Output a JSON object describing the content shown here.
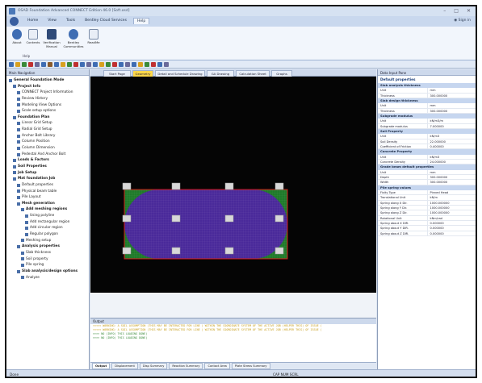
{
  "window": {
    "title": "OSAD Foundation Advanced CONNECT Edition 46.0 [Soft.osd]",
    "controls": [
      "–",
      "□",
      "✕"
    ]
  },
  "menubar": {
    "tabs": [
      {
        "label": "Home",
        "active": false
      },
      {
        "label": "View",
        "active": false
      },
      {
        "label": "Tools",
        "active": false
      },
      {
        "label": "Bentley Cloud Services",
        "active": false
      },
      {
        "label": "Help",
        "active": true
      }
    ],
    "signin": "Sign in"
  },
  "ribbon": {
    "buttons": [
      {
        "label": "About",
        "icon": "info-icon"
      },
      {
        "label": "Contents",
        "icon": "help-icon"
      },
      {
        "label": "Verification Manual",
        "icon": "book-icon"
      },
      {
        "label": "Bentley Communities",
        "icon": "community-icon"
      },
      {
        "label": "ReadMe",
        "icon": "document-icon"
      }
    ],
    "group_label": "Help"
  },
  "left_panel": {
    "title": "Main Navigation",
    "items": [
      {
        "label": "General Foundation Mode",
        "level": 0,
        "bold": true
      },
      {
        "label": "Project Info",
        "level": 1,
        "bold": true
      },
      {
        "label": "CONNECT Project Information",
        "level": 2,
        "bold": false
      },
      {
        "label": "Review History",
        "level": 2,
        "bold": false
      },
      {
        "label": "Modeling View Options",
        "level": 2,
        "bold": false
      },
      {
        "label": "Scale setup options",
        "level": 2,
        "bold": false
      },
      {
        "label": "Foundation Plan",
        "level": 1,
        "bold": true
      },
      {
        "label": "Linear Grid Setup",
        "level": 2,
        "bold": false
      },
      {
        "label": "Radial Grid Setup",
        "level": 2,
        "bold": false
      },
      {
        "label": "Anchor Bolt Library",
        "level": 2,
        "bold": false
      },
      {
        "label": "Column Position",
        "level": 2,
        "bold": false
      },
      {
        "label": "Column Dimension",
        "level": 2,
        "bold": false
      },
      {
        "label": "Pedestal And Anchor Bolt",
        "level": 2,
        "bold": false
      },
      {
        "label": "Loads & Factors",
        "level": 1,
        "bold": true
      },
      {
        "label": "Soil Properties",
        "level": 1,
        "bold": true
      },
      {
        "label": "Job Setup",
        "level": 1,
        "bold": true
      },
      {
        "label": "Mat foundation Job",
        "level": 1,
        "bold": true
      },
      {
        "label": "Default properties",
        "level": 2,
        "bold": false
      },
      {
        "label": "Physical beam table",
        "level": 2,
        "bold": false
      },
      {
        "label": "Pile Layout",
        "level": 2,
        "bold": false
      },
      {
        "label": "Mesh generation",
        "level": 2,
        "bold": true
      },
      {
        "label": "Add meshing regions",
        "level": 3,
        "bold": true
      },
      {
        "label": "Using polyline",
        "level": 4,
        "bold": false
      },
      {
        "label": "Add rectangular region",
        "level": 4,
        "bold": false
      },
      {
        "label": "Add circular region",
        "level": 4,
        "bold": false
      },
      {
        "label": "Regular polygon",
        "level": 4,
        "bold": false
      },
      {
        "label": "Meshing setup",
        "level": 3,
        "bold": false
      },
      {
        "label": "Analysis properties",
        "level": 2,
        "bold": true
      },
      {
        "label": "Slab thickness",
        "level": 3,
        "bold": false
      },
      {
        "label": "Soil property",
        "level": 3,
        "bold": false
      },
      {
        "label": "Pile spring",
        "level": 3,
        "bold": false
      },
      {
        "label": "Slab analysis/design options",
        "level": 2,
        "bold": true
      },
      {
        "label": "Analyze",
        "level": 3,
        "bold": false
      }
    ]
  },
  "doc_tabs": [
    {
      "label": "Start Page",
      "active": false
    },
    {
      "label": "Geometry",
      "active": true
    },
    {
      "label": "Detail and Schedule Drawing",
      "active": false
    },
    {
      "label": "GA Drawing",
      "active": false
    },
    {
      "label": "Calculation Sheet",
      "active": false
    },
    {
      "label": "Graphs",
      "active": false
    }
  ],
  "output": {
    "title": "Output",
    "lines": [
      {
        "text": "<<<<< WARNING: A SOIL ASSUMPTION (THIS MAY BE INTERACTED FOR LINE ) WITHIN THE COORDINATE SYSTEM OF THE ACTIVE JOB (HELPER THIS) OF ISSUE (",
        "kind": "warn"
      },
      {
        "text": "<<<<< WARNING: A SOIL ASSUMPTION (THIS MAY BE INTERACTED FOR LINE ) WITHIN THE COORDINATE SYSTEM OF THE ACTIVE JOB (HELPER THIS) OF ISSUE (",
        "kind": "warn"
      },
      {
        "text": ">>>> NO (INFO) THIS LOADING DONE)",
        "kind": "info"
      },
      {
        "text": ">>>> NO (INFO) THIS LOADING DONE)",
        "kind": "info"
      }
    ],
    "tabs": [
      {
        "label": "Output",
        "active": true
      },
      {
        "label": "Displacement",
        "active": false
      },
      {
        "label": "Disp Summary",
        "active": false
      },
      {
        "label": "Reaction Summary",
        "active": false
      },
      {
        "label": "Contact Area",
        "active": false
      },
      {
        "label": "Plate Stress Summary",
        "active": false
      }
    ]
  },
  "right_panel": {
    "title": "Data Input Pane",
    "heading": "Default properties",
    "rows": [
      {
        "type": "section",
        "label": "Slab analysis thickness"
      },
      {
        "type": "row",
        "key": "Unit",
        "value": "mm"
      },
      {
        "type": "row",
        "key": "Thickness",
        "value": "300.000000"
      },
      {
        "type": "section",
        "label": "Slab design thickness"
      },
      {
        "type": "row",
        "key": "Unit",
        "value": "mm"
      },
      {
        "type": "row",
        "key": "Thickness",
        "value": "300.000000"
      },
      {
        "type": "section",
        "label": "Subgrade modulus"
      },
      {
        "type": "row",
        "key": "Unit",
        "value": "kN/m3/m"
      },
      {
        "type": "row",
        "key": "Subgrade modulus",
        "value": "7.000000"
      },
      {
        "type": "section",
        "label": "Soil Property"
      },
      {
        "type": "row",
        "key": "Unit",
        "value": "kN/m3"
      },
      {
        "type": "row",
        "key": "Soil Density",
        "value": "22.000000"
      },
      {
        "type": "row",
        "key": "Coefficient of Friction",
        "value": "0.400000"
      },
      {
        "type": "section",
        "label": "Concrete Property"
      },
      {
        "type": "row",
        "key": "Unit",
        "value": "kN/m3"
      },
      {
        "type": "row",
        "key": "Concrete Density",
        "value": "24.000000"
      },
      {
        "type": "section",
        "label": "Grade beam default properties"
      },
      {
        "type": "row",
        "key": "Unit",
        "value": "mm"
      },
      {
        "type": "row",
        "key": "Depth",
        "value": "300.000000"
      },
      {
        "type": "row",
        "key": "Width",
        "value": "300.000000"
      },
      {
        "type": "section",
        "label": "Pile spring values"
      },
      {
        "type": "row",
        "key": "Fixity Type",
        "value": "Pinned Head"
      },
      {
        "type": "row",
        "key": "Translational Unit",
        "value": "kN/m"
      },
      {
        "type": "row",
        "key": "Spring along X Dir.",
        "value": "1000.000000"
      },
      {
        "type": "row",
        "key": "Spring along Y Dir.",
        "value": "1000.000000"
      },
      {
        "type": "row",
        "key": "Spring along Z Dir.",
        "value": "1000.000000"
      },
      {
        "type": "row",
        "key": "Rotational Unit",
        "value": "kNm/rad"
      },
      {
        "type": "row",
        "key": "Spring about X DIR.",
        "value": "0.000000"
      },
      {
        "type": "row",
        "key": "Spring about Y DIR.",
        "value": "0.000000"
      },
      {
        "type": "row",
        "key": "Spring about Z DIR.",
        "value": "0.000000"
      }
    ]
  },
  "status": {
    "left": "Done",
    "middle": "CAP  NUM  SCRL"
  },
  "colors": {
    "accent": "#3f6db3",
    "active_tab": "#ffd84a",
    "canvas_bg": "#050505",
    "mesh_purple": "#4a2a9a",
    "mesh_green": "#1f7a2a",
    "boundary_red": "#d01818"
  }
}
